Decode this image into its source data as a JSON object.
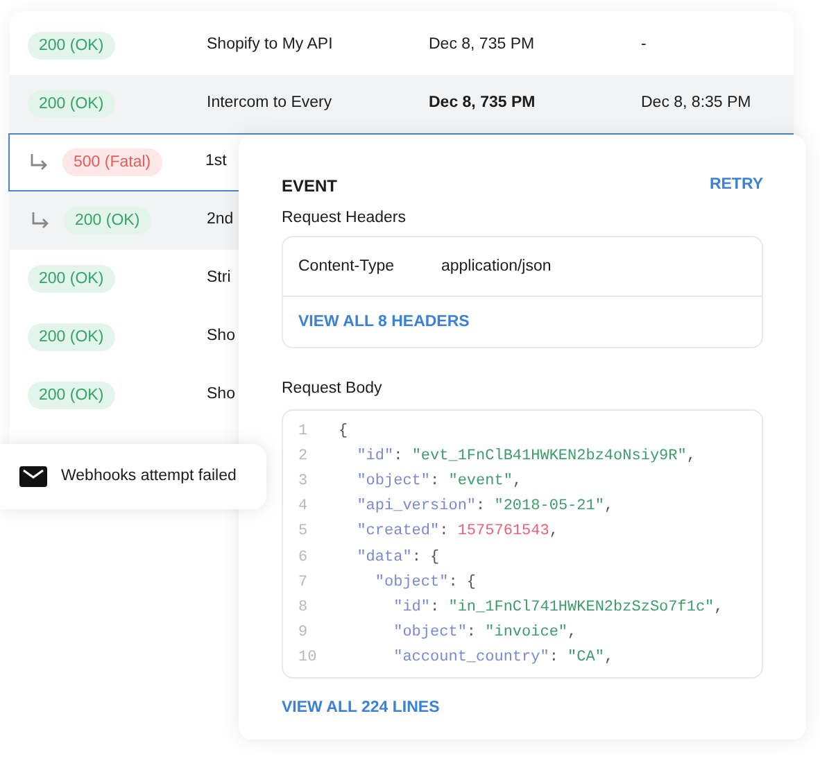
{
  "rows": [
    {
      "kind": "event",
      "status": {
        "label": "200 (OK)",
        "kind": "ok"
      },
      "name": "Shopify to My API",
      "date": "Dec 8, 735 PM",
      "date_bold": false,
      "column_4": "-",
      "selected": false,
      "shaded": false
    },
    {
      "kind": "event",
      "status": {
        "label": "200 (OK)",
        "kind": "ok"
      },
      "name": "Intercom to Every",
      "date": "Dec 8, 735 PM",
      "date_bold": true,
      "column_4": "Dec 8, 8:35 PM",
      "selected": false,
      "shaded": true
    },
    {
      "kind": "attempt",
      "status": {
        "label": "500 (Fatal)",
        "kind": "fatal"
      },
      "name": "1st",
      "selected": true,
      "shaded": false
    },
    {
      "kind": "attempt",
      "status": {
        "label": "200 (OK)",
        "kind": "ok"
      },
      "name": "2nd",
      "selected": false,
      "shaded": true
    },
    {
      "kind": "event",
      "status": {
        "label": "200 (OK)",
        "kind": "ok"
      },
      "name": "Stri",
      "selected": false,
      "shaded": false
    },
    {
      "kind": "event",
      "status": {
        "label": "200 (OK)",
        "kind": "ok"
      },
      "name": "Sho",
      "selected": false,
      "shaded": false
    },
    {
      "kind": "event",
      "status": {
        "label": "200 (OK)",
        "kind": "ok"
      },
      "name": "Sho",
      "selected": false,
      "shaded": false
    }
  ],
  "toast": {
    "text": "Webhooks attempt failed"
  },
  "panel": {
    "title": "EVENT",
    "action": "RETRY",
    "headers_label": "Request Headers",
    "headers": [
      {
        "name": "Content-Type",
        "value": "application/json"
      }
    ],
    "headers_link": "VIEW ALL 8 HEADERS",
    "body_label": "Request Body",
    "code": [
      {
        "number": "1",
        "tokens": [
          {
            "kind": "punct",
            "text": "{"
          }
        ]
      },
      {
        "number": "2",
        "tokens": [
          {
            "kind": "key",
            "text": "  \"id\""
          },
          {
            "kind": "punct",
            "text": ": "
          },
          {
            "kind": "string",
            "text": "\"evt_1FnClB41HWKEN2bz4oNsiy9R\""
          },
          {
            "kind": "punct",
            "text": ","
          }
        ]
      },
      {
        "number": "3",
        "tokens": [
          {
            "kind": "key",
            "text": "  \"object\""
          },
          {
            "kind": "punct",
            "text": ": "
          },
          {
            "kind": "string",
            "text": "\"event\""
          },
          {
            "kind": "punct",
            "text": ","
          }
        ]
      },
      {
        "number": "4",
        "tokens": [
          {
            "kind": "key",
            "text": "  \"api_version\""
          },
          {
            "kind": "punct",
            "text": ": "
          },
          {
            "kind": "string",
            "text": "\"2018-05-21\""
          },
          {
            "kind": "punct",
            "text": ","
          }
        ]
      },
      {
        "number": "5",
        "tokens": [
          {
            "kind": "key",
            "text": "  \"created\""
          },
          {
            "kind": "punct",
            "text": ": "
          },
          {
            "kind": "number",
            "text": "1575761543"
          },
          {
            "kind": "punct",
            "text": ","
          }
        ]
      },
      {
        "number": "6",
        "tokens": [
          {
            "kind": "key",
            "text": "  \"data\""
          },
          {
            "kind": "punct",
            "text": ": {"
          }
        ]
      },
      {
        "number": "7",
        "tokens": [
          {
            "kind": "key",
            "text": "    \"object\""
          },
          {
            "kind": "punct",
            "text": ": {"
          }
        ]
      },
      {
        "number": "8",
        "tokens": [
          {
            "kind": "key",
            "text": "      \"id\""
          },
          {
            "kind": "punct",
            "text": ": "
          },
          {
            "kind": "string",
            "text": "\"in_1FnCl741HWKEN2bzSzSo7f1c\""
          },
          {
            "kind": "punct",
            "text": ","
          }
        ]
      },
      {
        "number": "9",
        "tokens": [
          {
            "kind": "key",
            "text": "      \"object\""
          },
          {
            "kind": "punct",
            "text": ": "
          },
          {
            "kind": "string",
            "text": "\"invoice\""
          },
          {
            "kind": "punct",
            "text": ","
          }
        ]
      },
      {
        "number": "10",
        "tokens": [
          {
            "kind": "key",
            "text": "      \"account_country\""
          },
          {
            "kind": "punct",
            "text": ": "
          },
          {
            "kind": "string",
            "text": "\"CA\""
          },
          {
            "kind": "punct",
            "text": ","
          }
        ]
      }
    ],
    "body_link": "VIEW ALL 224 LINES"
  }
}
